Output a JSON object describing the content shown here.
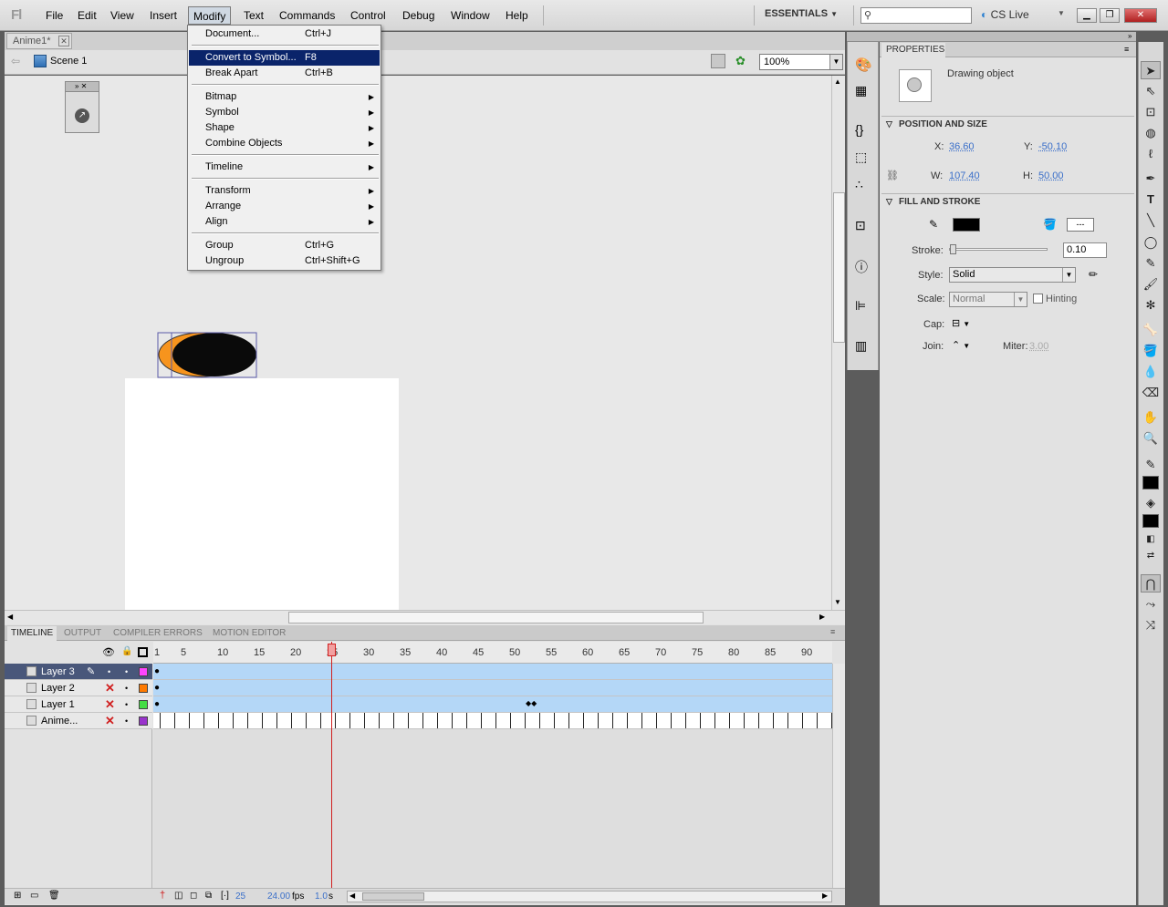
{
  "app": {
    "logo": "Fl"
  },
  "menubar": {
    "items": [
      "File",
      "Edit",
      "View",
      "Insert",
      "Modify",
      "Text",
      "Commands",
      "Control",
      "Debug",
      "Window",
      "Help"
    ],
    "workspace": "ESSENTIALS",
    "cs_live": "CS Live"
  },
  "document": {
    "tab": "Anime1*",
    "scene": "Scene 1",
    "zoom": "100%"
  },
  "modify_menu": {
    "document": "Document...",
    "document_sc": "Ctrl+J",
    "convert": "Convert to Symbol...",
    "convert_sc": "F8",
    "break_apart": "Break Apart",
    "break_apart_sc": "Ctrl+B",
    "bitmap": "Bitmap",
    "symbol": "Symbol",
    "shape": "Shape",
    "combine": "Combine Objects",
    "timeline": "Timeline",
    "transform": "Transform",
    "arrange": "Arrange",
    "align": "Align",
    "group": "Group",
    "group_sc": "Ctrl+G",
    "ungroup": "Ungroup",
    "ungroup_sc": "Ctrl+Shift+G"
  },
  "timeline": {
    "tabs": [
      "TIMELINE",
      "OUTPUT",
      "COMPILER ERRORS",
      "MOTION EDITOR"
    ],
    "ticks": [
      "1",
      "5",
      "10",
      "15",
      "20",
      "25",
      "30",
      "35",
      "40",
      "45",
      "50",
      "55",
      "60",
      "65",
      "70",
      "75",
      "80",
      "85",
      "90"
    ],
    "layers": [
      {
        "name": "Layer 3",
        "color": "#ff44ff"
      },
      {
        "name": "Layer 2",
        "color": "#ff7a00"
      },
      {
        "name": "Layer 1",
        "color": "#44dd44"
      },
      {
        "name": "Anime...",
        "color": "#9933cc"
      }
    ],
    "current_frame": "25",
    "fps": "24.00",
    "fps_unit": "fps",
    "elapsed": "1.0",
    "elapsed_unit": "s"
  },
  "properties": {
    "tab": "PROPERTIES",
    "object_type": "Drawing object",
    "position_size": "POSITION AND SIZE",
    "x_label": "X:",
    "x": "36.60",
    "y_label": "Y:",
    "y": "-50.10",
    "w_label": "W:",
    "w": "107.40",
    "h_label": "H:",
    "h": "50.00",
    "fill_stroke": "FILL AND STROKE",
    "stroke_label": "Stroke:",
    "stroke": "0.10",
    "style_label": "Style:",
    "style": "Solid",
    "scale_label": "Scale:",
    "scale": "Normal",
    "hinting": "Hinting",
    "cap_label": "Cap:",
    "join_label": "Join:",
    "miter_label": "Miter:",
    "miter": "3.00"
  }
}
